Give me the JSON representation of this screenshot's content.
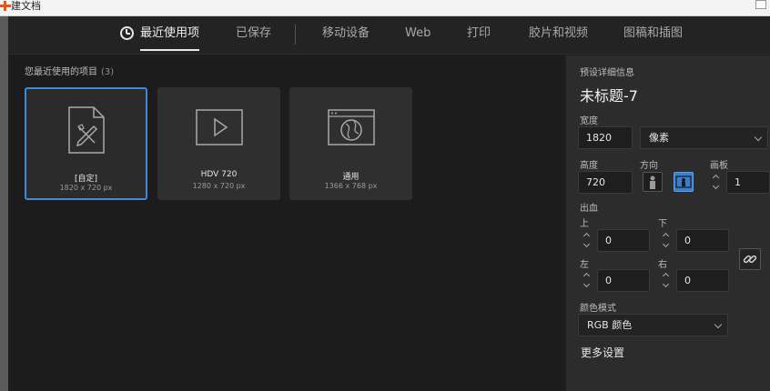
{
  "window": {
    "title": "建文档"
  },
  "nav": {
    "tabs": [
      {
        "label": "最近使用项",
        "active": true
      },
      {
        "label": "已保存"
      },
      {
        "label": "移动设备"
      },
      {
        "label": "Web"
      },
      {
        "label": "打印"
      },
      {
        "label": "胶片和视频"
      },
      {
        "label": "图稿和插图"
      }
    ]
  },
  "recent": {
    "title": "您最近使用的项目",
    "count": "(3)",
    "items": [
      {
        "name": "[自定]",
        "size": "1820 x 720 px",
        "icon": "custom-doc-icon",
        "selected": true
      },
      {
        "name": "HDV 720",
        "size": "1280 x 720 px",
        "icon": "video-play-icon"
      },
      {
        "name": "通用",
        "size": "1366 x 768 px",
        "icon": "web-globe-icon"
      }
    ]
  },
  "panel": {
    "heading": "预设详细信息",
    "doc_title": "未标题-7",
    "width_label": "宽度",
    "width_value": "1820",
    "unit": "像素",
    "height_label": "高度",
    "height_value": "720",
    "orientation_label": "方向",
    "artboard_label": "画板",
    "artboard_value": "1",
    "bleed_label": "出血",
    "top_label": "上",
    "top_value": "0",
    "bottom_label": "下",
    "bottom_value": "0",
    "left_label": "左",
    "left_value": "0",
    "right_label": "右",
    "right_value": "0",
    "color_mode_label": "颜色模式",
    "color_mode": "RGB 颜色",
    "more_settings": "更多设置"
  },
  "colors": {
    "accent": "#3f8ad8",
    "background": "#1c1c1c",
    "panel": "#2c2c2c"
  }
}
